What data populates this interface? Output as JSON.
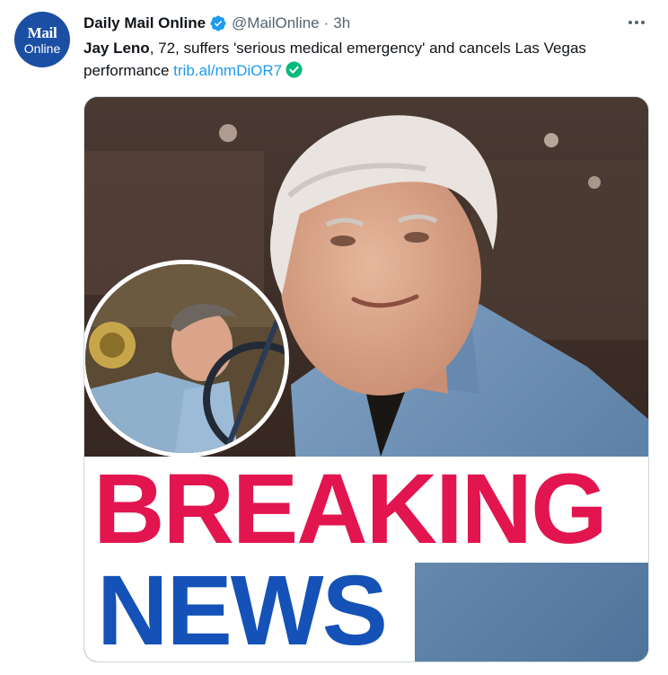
{
  "account": {
    "avatar_line1": "Mail",
    "avatar_line2": "Online",
    "display_name": "Daily Mail Online",
    "handle": "@MailOnline",
    "separator": "·",
    "time": "3h"
  },
  "tweet": {
    "name_bold": "Jay Leno",
    "text_rest": ", 72, suffers 'serious medical emergency' and cancels Las Vegas performance ",
    "link": "trib.al/nmDiOR7"
  },
  "media": {
    "headline_line1": "BREAKING",
    "headline_line2": "NEWS"
  },
  "colors": {
    "verified": "#1d9bf0",
    "link": "#1d9bf0",
    "link_check": "#00ba7c",
    "breaking": "#e2154e",
    "news": "#1452b8"
  },
  "icons": {
    "verified": "verified-badge-icon",
    "more": "more-options-icon",
    "link_check": "check-mark-icon"
  }
}
